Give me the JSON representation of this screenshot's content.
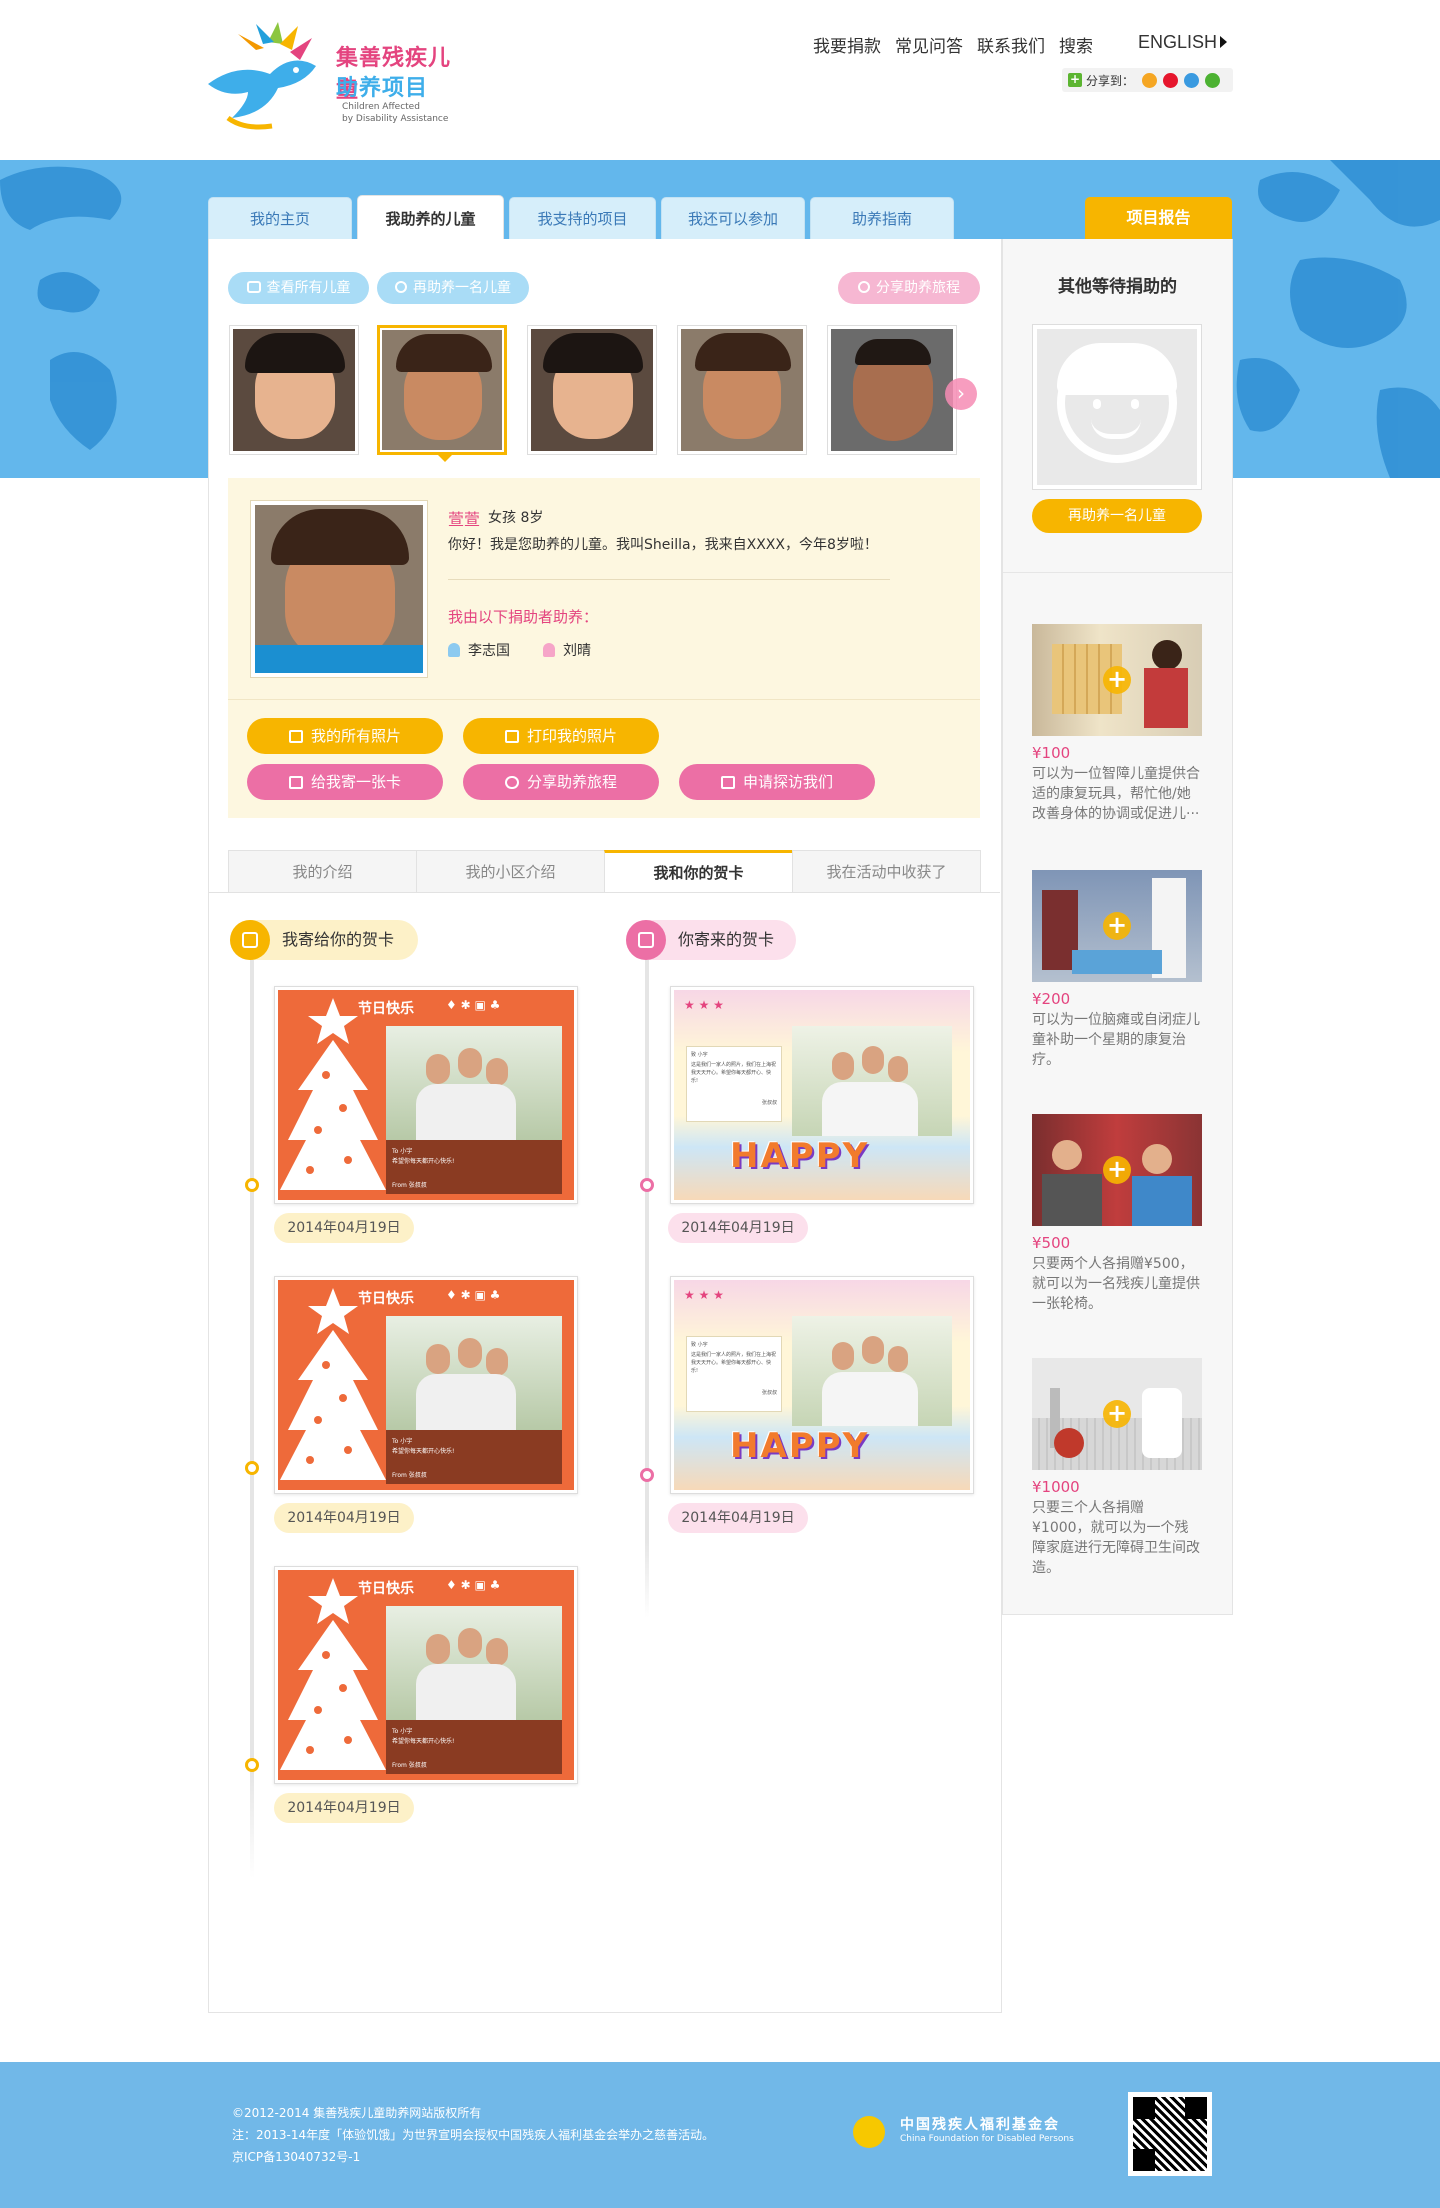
{
  "brand": {
    "logo_cn_line1": "集善残疾儿童",
    "logo_cn_line2": "助养项目",
    "logo_en_line1": "Children Affected",
    "logo_en_line2": "by Disability Assistance"
  },
  "topnav": {
    "donate": "我要捐款",
    "faq": "常见问答",
    "contact": "联系我们",
    "search": "搜索",
    "english": "ENGLISH",
    "share_label": "分享到："
  },
  "tabs": [
    "我的主页",
    "我助养的儿童",
    "我支持的项目",
    "我还可以参加",
    "助养指南"
  ],
  "report_tab": "项目报告",
  "actions": {
    "view_all": "查看所有儿童",
    "adopt_more": "再助养一名儿童",
    "share_journey": "分享助养旅程"
  },
  "child": {
    "name": "萱萱",
    "gender_age": "女孩  8岁",
    "intro": "你好！我是您助养的儿童。我叫Sheilla，我来自XXXX，今年8岁啦！",
    "sponsors_title": "我由以下捐助者助养：",
    "sponsors": [
      "李志国",
      "刘晴"
    ]
  },
  "profile_buttons": {
    "all_photos": "我的所有照片",
    "print_photos": "打印我的照片",
    "send_card": "给我寄一张卡",
    "share_journey": "分享助养旅程",
    "visit": "申请探访我们"
  },
  "section_tabs": [
    "我的介绍",
    "我的小区介绍",
    "我和你的贺卡",
    "我在活动中收获了"
  ],
  "cards": {
    "sent_title": "我寄给你的贺卡",
    "received_title": "你寄来的贺卡",
    "xmas_title": "节日快乐",
    "xmas_to": "To  小宇",
    "xmas_msg": "希望你每天都开心快乐!",
    "xmas_from": "From  张叔叔",
    "happy_to": "致  小宇",
    "happy_msg": "这是我们一家人的照片，我们在上海祝我天天开心。希望你每天都开心、快乐!",
    "happy_from": "张叔叔",
    "happy_word": "HAPPY",
    "sent_dates": [
      "2014年04月19日",
      "2014年04月19日",
      "2014年04月19日"
    ],
    "received_dates": [
      "2014年04月19日",
      "2014年04月19日"
    ]
  },
  "sidebar": {
    "title": "其他等待捐助的",
    "adopt_button": "再助养一名儿童",
    "items": [
      {
        "price": "¥100",
        "desc": "可以为一位智障儿童提供合适的康复玩具，帮忙他/她改善身体的协调或促进儿···"
      },
      {
        "price": "¥200",
        "desc": "可以为一位脑瘫或自闭症儿童补助一个星期的康复治疗。"
      },
      {
        "price": "¥500",
        "desc": "只要两个人各捐赠¥500，就可以为一名残疾儿童提供一张轮椅。"
      },
      {
        "price": "¥1000",
        "desc": "只要三个人各捐赠¥1000，就可以为一个残障家庭进行无障碍卫生间改造。"
      }
    ]
  },
  "footer": {
    "copyright": "©2012-2014 集善残疾儿童助养网站版权所有",
    "note": "注：2013-14年度「体验饥饿」为世界宣明会授权中国残疾人福利基金会举办之慈善活动。",
    "icp": "京ICP备13040732号-1",
    "foundation_cn": "中国残疾人福利基金会",
    "foundation_en": "China Foundation for Disabled Persons"
  },
  "colors": {
    "accent_yellow": "#f7b500",
    "accent_pink": "#ec6fa5",
    "light_blue": "#a9dcf6",
    "banner_blue": "#63b7ec",
    "footer_blue": "#71b8e8"
  }
}
